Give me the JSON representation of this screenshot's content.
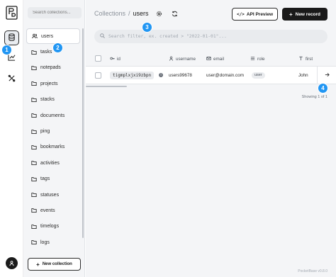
{
  "rail": {
    "logo": "pocketbase-logo",
    "items": [
      "database-icon",
      "chart-icon",
      "tools-icon"
    ]
  },
  "sidebar": {
    "search_placeholder": "Search collections...",
    "items": [
      {
        "label": "users",
        "icon": "users-icon",
        "active": true
      },
      {
        "label": "tasks",
        "icon": "folder-icon"
      },
      {
        "label": "notepads",
        "icon": "folder-icon"
      },
      {
        "label": "projects",
        "icon": "folder-icon"
      },
      {
        "label": "stacks",
        "icon": "folder-icon"
      },
      {
        "label": "documents",
        "icon": "folder-icon"
      },
      {
        "label": "ping",
        "icon": "folder-icon"
      },
      {
        "label": "bookmarks",
        "icon": "folder-icon"
      },
      {
        "label": "activities",
        "icon": "folder-icon"
      },
      {
        "label": "tags",
        "icon": "folder-icon"
      },
      {
        "label": "statuses",
        "icon": "folder-icon"
      },
      {
        "label": "events",
        "icon": "folder-icon"
      },
      {
        "label": "timelogs",
        "icon": "folder-icon"
      },
      {
        "label": "logs",
        "icon": "folder-icon"
      }
    ],
    "new_collection": "New collection"
  },
  "header": {
    "breadcrumb_root": "Collections",
    "breadcrumb_sep": "/",
    "breadcrumb_current": "users",
    "api_preview": "API Preview",
    "api_icon": "</>",
    "new_record": "New record"
  },
  "filter": {
    "placeholder": "Search filter, ex. created > \"2022-01-01\"..."
  },
  "table": {
    "columns": [
      {
        "label": "id",
        "icon": "key-icon"
      },
      {
        "label": "username",
        "icon": "user-icon"
      },
      {
        "label": "email",
        "icon": "mail-icon"
      },
      {
        "label": "role",
        "icon": "list-icon"
      },
      {
        "label": "first",
        "icon": "text-icon"
      }
    ],
    "rows": [
      {
        "id": "tigmplxjxi9zbpn",
        "username": "users99678",
        "email": "user@domain.com",
        "role": "user",
        "first": "John"
      }
    ],
    "showing": "Showing 1 of 1"
  },
  "footer": "PocketBase v0.8.0",
  "markers": [
    "1",
    "2",
    "3",
    "4"
  ],
  "colors": {
    "marker": "#2196f3",
    "primary": "#1a1a1a",
    "sidebar_bg": "#f4f5f7"
  }
}
